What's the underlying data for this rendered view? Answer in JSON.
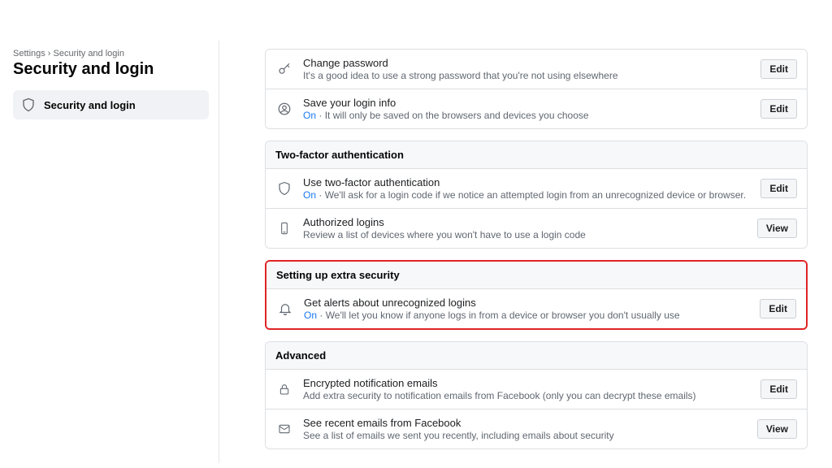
{
  "breadcrumb": "Settings › Security and login",
  "pageTitle": "Security and login",
  "sidebar": {
    "item0": {
      "label": "Security and login"
    }
  },
  "buttons": {
    "edit": "Edit",
    "view": "View"
  },
  "status": {
    "on": "On"
  },
  "sections": {
    "login": {
      "changePassword": {
        "title": "Change password",
        "desc": "It's a good idea to use a strong password that you're not using elsewhere"
      },
      "saveLogin": {
        "title": "Save your login info",
        "desc": "It will only be saved on the browsers and devices you choose"
      }
    },
    "twofa": {
      "header": "Two-factor authentication",
      "useTwofa": {
        "title": "Use two-factor authentication",
        "desc": "We'll ask for a login code if we notice an attempted login from an unrecognized device or browser."
      },
      "authorized": {
        "title": "Authorized logins",
        "desc": "Review a list of devices where you won't have to use a login code"
      }
    },
    "extra": {
      "header": "Setting up extra security",
      "alerts": {
        "title": "Get alerts about unrecognized logins",
        "desc": "We'll let you know if anyone logs in from a device or browser you don't usually use"
      }
    },
    "advanced": {
      "header": "Advanced",
      "encrypted": {
        "title": "Encrypted notification emails",
        "desc": "Add extra security to notification emails from Facebook (only you can decrypt these emails)"
      },
      "recentEmails": {
        "title": "See recent emails from Facebook",
        "desc": "See a list of emails we sent you recently, including emails about security"
      }
    }
  }
}
